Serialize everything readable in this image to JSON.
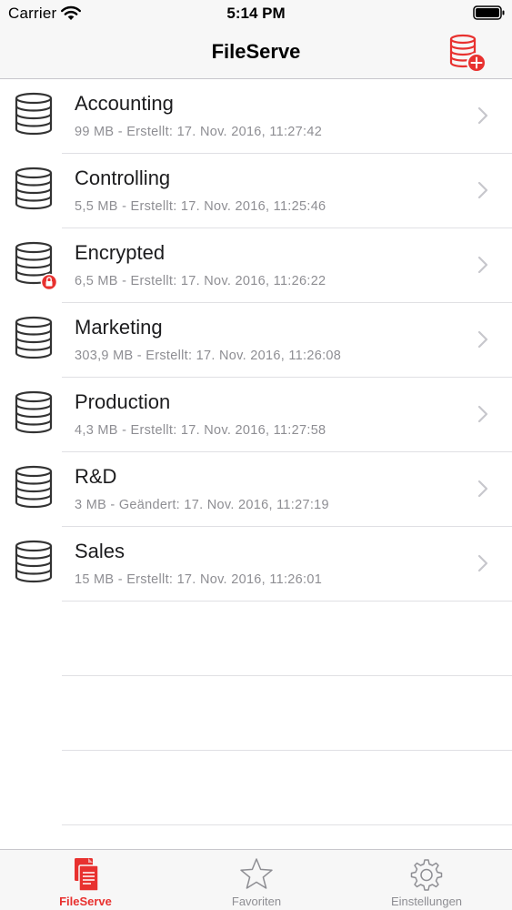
{
  "status_bar": {
    "carrier": "Carrier",
    "time": "5:14 PM"
  },
  "nav": {
    "title": "FileServe",
    "add_icon": "database-add-icon"
  },
  "colors": {
    "accent": "#e8312f",
    "subtitle": "#8e8e93",
    "separator": "#e0e0e4"
  },
  "shares": [
    {
      "name": "Accounting",
      "details": "99 MB - Erstellt: 17. Nov. 2016, 11:27:42",
      "icon": "database-icon",
      "locked": false
    },
    {
      "name": "Controlling",
      "details": "5,5 MB - Erstellt: 17. Nov. 2016, 11:25:46",
      "icon": "database-icon",
      "locked": false
    },
    {
      "name": "Encrypted",
      "details": "6,5 MB - Erstellt: 17. Nov. 2016, 11:26:22",
      "icon": "database-icon",
      "locked": true
    },
    {
      "name": "Marketing",
      "details": "303,9 MB - Erstellt: 17. Nov. 2016, 11:26:08",
      "icon": "database-icon",
      "locked": false
    },
    {
      "name": "Production",
      "details": "4,3 MB - Erstellt: 17. Nov. 2016, 11:27:58",
      "icon": "database-icon",
      "locked": false
    },
    {
      "name": "R&D",
      "details": "3 MB - Geändert: 17. Nov. 2016, 11:27:19",
      "icon": "database-icon",
      "locked": false
    },
    {
      "name": "Sales",
      "details": "15 MB - Erstellt: 17. Nov. 2016, 11:26:01",
      "icon": "database-icon",
      "locked": false
    }
  ],
  "tab_bar": {
    "tabs": [
      {
        "label": "FileServe",
        "icon": "documents-icon",
        "active": true
      },
      {
        "label": "Favoriten",
        "icon": "star-icon",
        "active": false
      },
      {
        "label": "Einstellungen",
        "icon": "gear-icon",
        "active": false
      }
    ]
  }
}
